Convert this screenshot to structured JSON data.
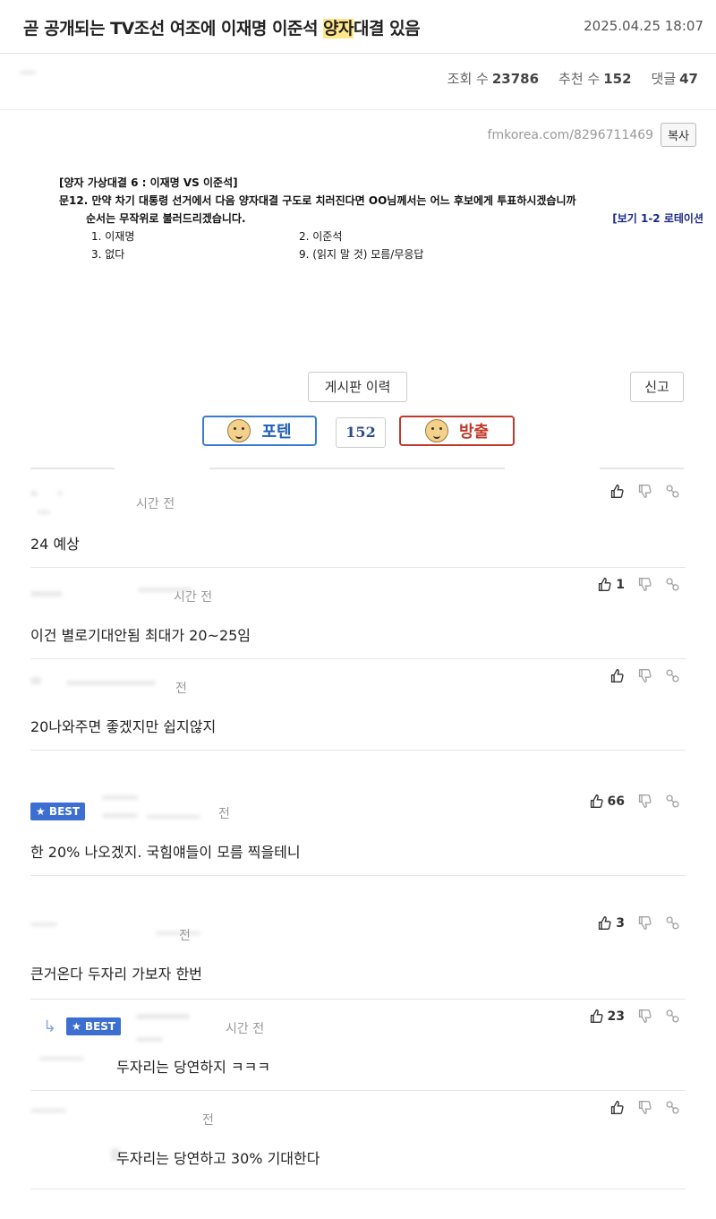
{
  "post": {
    "title_pre": "곧 공개되는 TV조선 여조에 이재명 이준석 ",
    "title_hl": "양자",
    "title_post": "대결 있음",
    "date": "2025.04.25 18:07",
    "views_label": "조회 수",
    "views": "23786",
    "recommend_label": "추천 수",
    "recommend": "152",
    "comments_label": "댓글",
    "comments": "47",
    "url": "fmkorea.com/8296711469",
    "copy_label": "복사"
  },
  "survey": {
    "heading": "[양자 가상대결 6 : 이재명 VS 이준석]",
    "question": "문12. 만약 차기 대통령 선거에서 다음 양자대결 구도로 치러진다면 OO님께서는 어느 후보에게 투표하시겠습니까",
    "order_note": "순서는 무작위로 불러드리겠습니다.",
    "rotation_note": "[보기 1-2 로테이션",
    "options": [
      "1. 이재명",
      "2. 이준석",
      "3. 없다",
      "9. (읽지 말 것) 모름/무응답"
    ]
  },
  "buttons": {
    "history": "게시판 이력",
    "report": "신고",
    "upvote": "포텐",
    "downvote": "방출",
    "vote_count": "152"
  },
  "comments": [
    {
      "time": "시간 전",
      "text": "24 예상",
      "likes": "",
      "best": false,
      "reply": false
    },
    {
      "time": "시간 전",
      "text": "이건 별로기대안됨 최대가 20~25임",
      "likes": "1",
      "best": false,
      "reply": false
    },
    {
      "time": "전",
      "text": "20나와주면 좋겠지만 쉽지않지",
      "likes": "",
      "best": false,
      "reply": false
    },
    {
      "time": "전",
      "text": "한 20% 나오겠지. 국힘얘들이 모름 찍을테니",
      "likes": "66",
      "best": true,
      "reply": false
    },
    {
      "time": "전",
      "text": "큰거온다 두자리 가보자 한번",
      "likes": "3",
      "best": false,
      "reply": false
    },
    {
      "time": "시간 전",
      "text": "두자리는 당연하지 ㅋㅋㅋ",
      "likes": "23",
      "best": true,
      "reply": true
    },
    {
      "time": "전",
      "text": "두자리는 당연하고 30% 기대한다",
      "likes": "",
      "best": false,
      "reply": false
    }
  ],
  "best_label": "★ BEST",
  "icons": {
    "like": "thumbs-up-icon",
    "dislike": "thumbs-down-icon",
    "link": "link-icon",
    "reply": "reply-arrow-icon"
  },
  "colors": {
    "highlight": "#ffe78a",
    "best_badge": "#3c6fd1",
    "upvote": "#3a7bd5",
    "downvote": "#c0392b"
  }
}
